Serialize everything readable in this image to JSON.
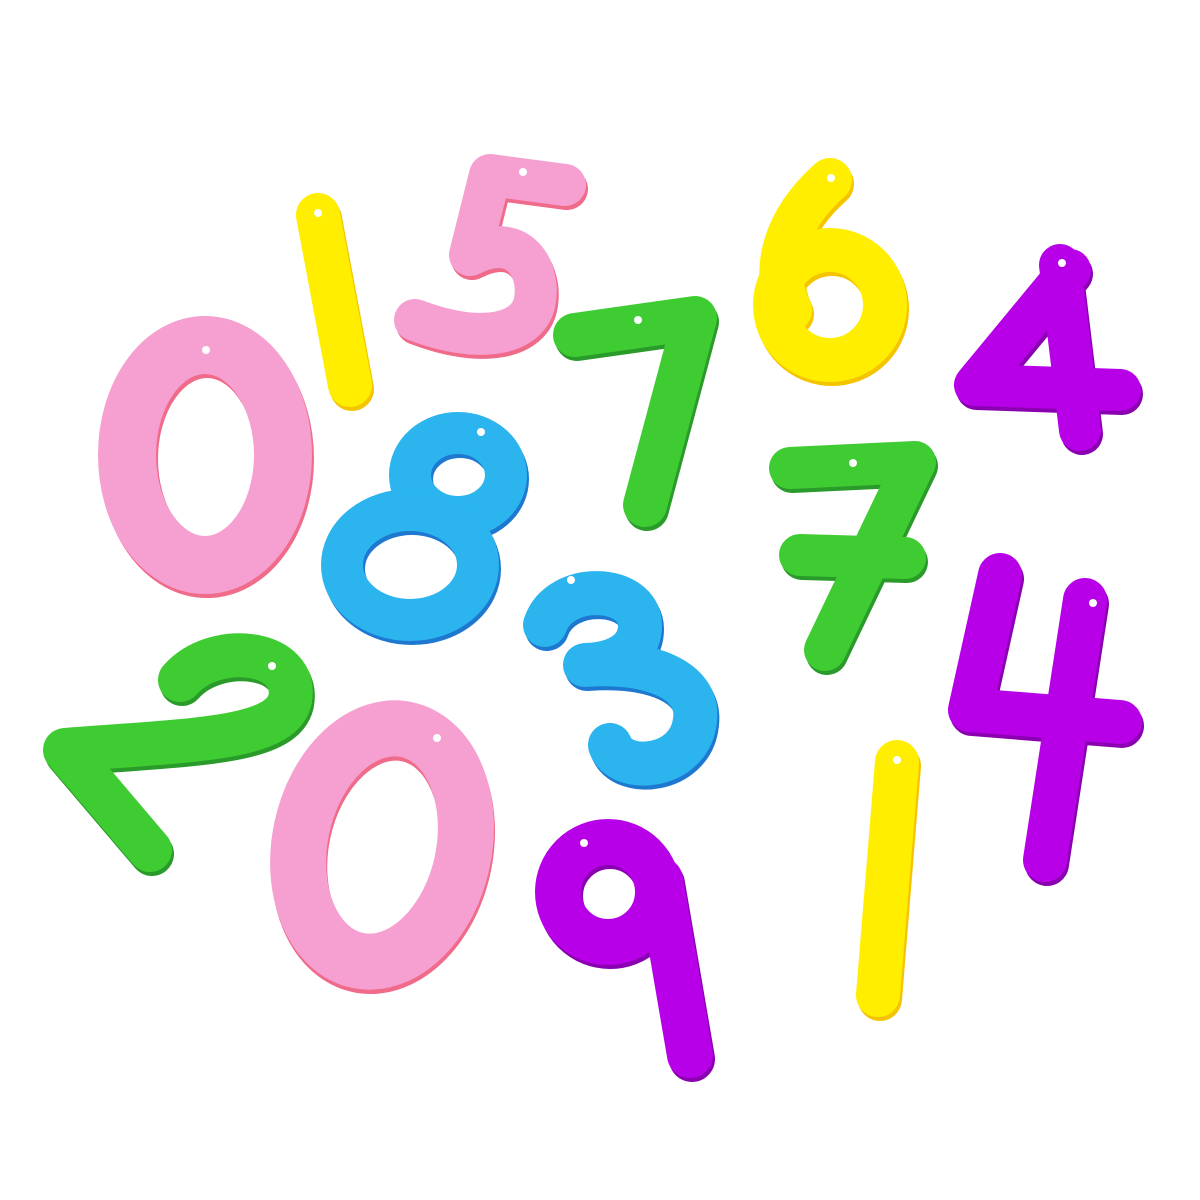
{
  "scene": "numerals",
  "colors": {
    "pink": "#f5a0d0",
    "pink_edge": "#f06a8a",
    "yellow": "#ffee00",
    "yellow_edge": "#f5c400",
    "green": "#3fcc32",
    "green_edge": "#2a9a2a",
    "blue": "#2bb4ee",
    "blue_edge": "#1e78d0",
    "purple": "#b700e8",
    "purple_edge": "#8a00b0",
    "background": "#ffffff"
  },
  "numerals": [
    {
      "digit": "0",
      "color": "pink"
    },
    {
      "digit": "1",
      "color": "yellow"
    },
    {
      "digit": "5",
      "color": "pink"
    },
    {
      "digit": "7",
      "color": "green"
    },
    {
      "digit": "6",
      "color": "yellow"
    },
    {
      "digit": "4",
      "color": "purple"
    },
    {
      "digit": "8",
      "color": "blue"
    },
    {
      "digit": "7",
      "color": "green"
    },
    {
      "digit": "3",
      "color": "blue"
    },
    {
      "digit": "4",
      "color": "purple"
    },
    {
      "digit": "2",
      "color": "green"
    },
    {
      "digit": "0",
      "color": "pink"
    },
    {
      "digit": "9",
      "color": "purple"
    },
    {
      "digit": "1",
      "color": "yellow"
    }
  ]
}
